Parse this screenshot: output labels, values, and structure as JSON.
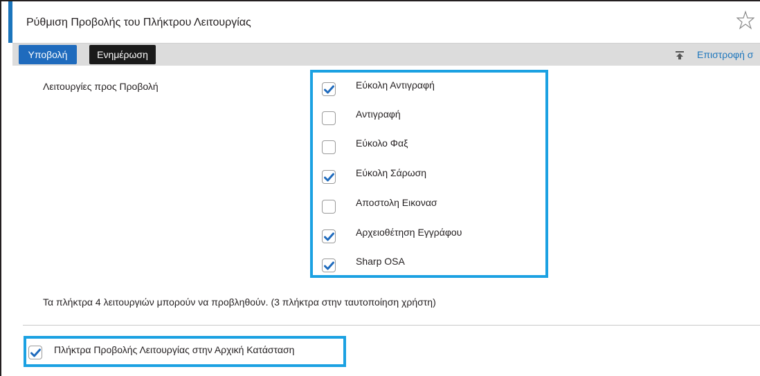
{
  "header": {
    "title": "Ρύθμιση Προβολής του Πλήκτρου Λειτουργίας",
    "favorite_icon": "star-outline-icon"
  },
  "toolbar": {
    "view_label": "Υποβολή",
    "update_label": "Ενημέρωση",
    "back_icon": "return-to-top-icon",
    "back_label": "Επιστροφή σ"
  },
  "functions": {
    "label": "Λειτουργίες προς Προβολή",
    "options": [
      {
        "label": "Εύκολη Αντιγραφή",
        "checked": true
      },
      {
        "label": "Αντιγραφή",
        "checked": false
      },
      {
        "label": "Εύκολο Φαξ",
        "checked": false
      },
      {
        "label": "Εύκολη Σάρωση",
        "checked": true
      },
      {
        "label": "Αποστολη Εικονασ",
        "checked": false
      },
      {
        "label": "Αρχειοθέτηση Εγγράφου",
        "checked": true
      },
      {
        "label": "Sharp OSA",
        "checked": true
      }
    ],
    "note": "Τα πλήκτρα 4 λειτουργιών μπορούν να προβληθούν. (3 πλήκτρα στην ταυτοποίηση χρήστη)"
  },
  "initial_state": {
    "label": "Πλήκτρα Προβολής Λειτουργίας στην Αρχική Κατάσταση",
    "checked": true
  },
  "colors": {
    "accent": "#1b75bc",
    "highlight": "#1ba1e2",
    "check": "#1f6bbd"
  }
}
